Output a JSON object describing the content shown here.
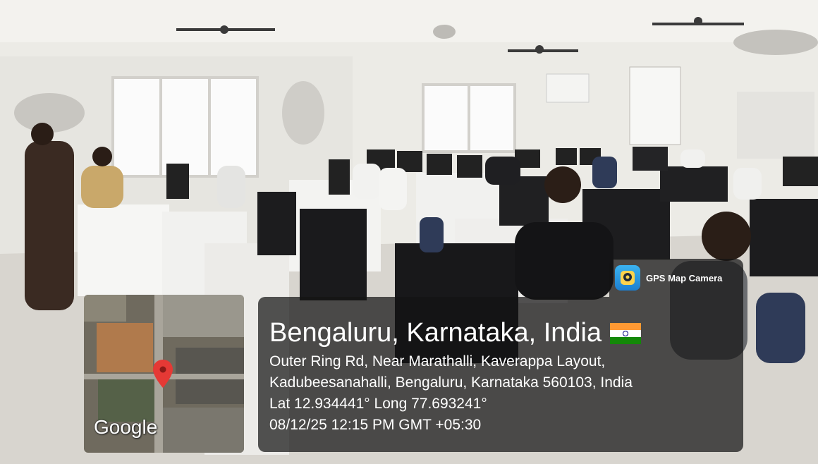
{
  "badge": {
    "app_name": "GPS Map Camera",
    "icon": "gps-camera-app-icon"
  },
  "location": {
    "city_line": "Bengaluru, Karnataka, India",
    "flag": "india-flag-icon",
    "address_line_1": "Outer Ring Rd, Near Marathalli, Kaverappa Layout,",
    "address_line_2": "Kadubeesanahalli, Bengaluru, Karnataka 560103, India",
    "coordinates": "Lat 12.934441° Long 77.693241°",
    "timestamp": "08/12/25 12:15 PM GMT +05:30"
  },
  "map": {
    "provider_label": "Google",
    "pin": "map-pin-icon"
  },
  "colors": {
    "overlay": "#141414",
    "flag_saffron": "#ff9933",
    "flag_green": "#138808",
    "chakra": "#000080",
    "pin": "#e53935"
  }
}
